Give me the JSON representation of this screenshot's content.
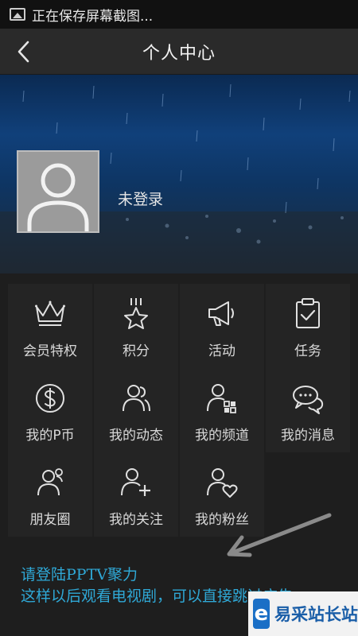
{
  "status_bar": {
    "text": "正在保存屏幕截图..."
  },
  "nav": {
    "title": "个人中心"
  },
  "profile": {
    "login_status": "未登录"
  },
  "menu": [
    {
      "label": "会员特权",
      "icon": "crown-icon"
    },
    {
      "label": "积分",
      "icon": "star-icon"
    },
    {
      "label": "活动",
      "icon": "megaphone-icon"
    },
    {
      "label": "任务",
      "icon": "clipboard-check-icon"
    },
    {
      "label": "我的P币",
      "icon": "coin-icon"
    },
    {
      "label": "我的动态",
      "icon": "users-icon"
    },
    {
      "label": "我的频道",
      "icon": "user-channel-icon"
    },
    {
      "label": "我的消息",
      "icon": "chat-icon"
    },
    {
      "label": "朋友圈",
      "icon": "friends-icon"
    },
    {
      "label": "我的关注",
      "icon": "user-add-icon"
    },
    {
      "label": "我的粉丝",
      "icon": "user-heart-icon"
    }
  ],
  "annotation": {
    "line1": "请登陆PPTV聚力",
    "line2": "这样以后观看电视剧，可以直接跳过广告"
  },
  "watermark": {
    "text": "易采站长站"
  },
  "colors": {
    "annotation": "#2fa8d6",
    "icon_stroke": "#e0e0e0",
    "cell_bg": "#242424"
  }
}
